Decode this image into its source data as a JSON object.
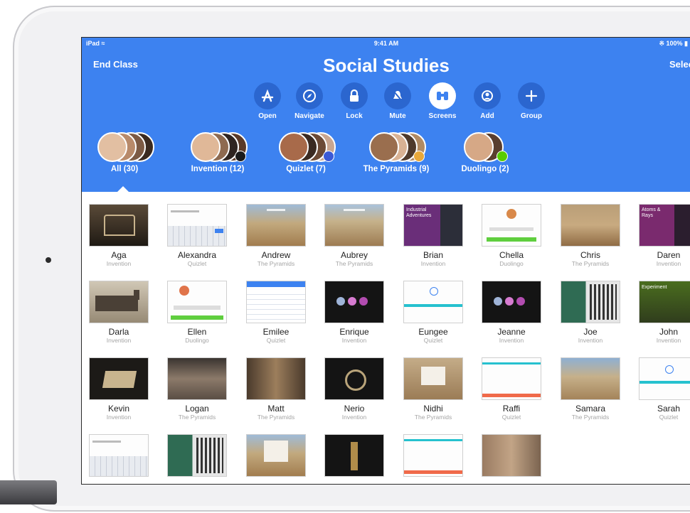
{
  "status_bar": {
    "device": "iPad",
    "time": "9:41 AM",
    "battery": "100%"
  },
  "header": {
    "end_class": "End Class",
    "title": "Social Studies",
    "select": "Select"
  },
  "toolbar": [
    {
      "label": "Open",
      "icon": "app-store-icon"
    },
    {
      "label": "Navigate",
      "icon": "compass-icon"
    },
    {
      "label": "Lock",
      "icon": "lock-icon"
    },
    {
      "label": "Mute",
      "icon": "mute-bell-icon"
    },
    {
      "label": "Screens",
      "icon": "binoculars-icon",
      "active": true
    },
    {
      "label": "Add",
      "icon": "add-student-icon"
    },
    {
      "label": "Group",
      "icon": "plus-icon"
    }
  ],
  "groups": [
    {
      "label": "All (30)",
      "selected": true
    },
    {
      "label": "Invention (12)"
    },
    {
      "label": "Quizlet (7)"
    },
    {
      "label": "The Pyramids (9)"
    },
    {
      "label": "Duolingo (2)"
    }
  ],
  "students": [
    {
      "name": "Aga",
      "app": "Invention"
    },
    {
      "name": "Alexandra",
      "app": "Quizlet"
    },
    {
      "name": "Andrew",
      "app": "The Pyramids"
    },
    {
      "name": "Aubrey",
      "app": "The Pyramids"
    },
    {
      "name": "Brian",
      "app": "Invention",
      "thumb_text": "Industrial Adventures"
    },
    {
      "name": "Chella",
      "app": "Duolingo"
    },
    {
      "name": "Chris",
      "app": "The Pyramids"
    },
    {
      "name": "Daren",
      "app": "Invention",
      "thumb_text": "Atoms & Rays"
    },
    {
      "name": "Darla",
      "app": "Invention"
    },
    {
      "name": "Ellen",
      "app": "Duolingo"
    },
    {
      "name": "Emilee",
      "app": "Quizlet"
    },
    {
      "name": "Enrique",
      "app": "Invention"
    },
    {
      "name": "Eungee",
      "app": "Quizlet"
    },
    {
      "name": "Jeanne",
      "app": "Invention"
    },
    {
      "name": "Joe",
      "app": "Invention"
    },
    {
      "name": "John",
      "app": "Invention",
      "thumb_text": "Experiment"
    },
    {
      "name": "Kevin",
      "app": "Invention"
    },
    {
      "name": "Logan",
      "app": "The Pyramids"
    },
    {
      "name": "Matt",
      "app": "The Pyramids"
    },
    {
      "name": "Nerio",
      "app": "Invention"
    },
    {
      "name": "Nidhi",
      "app": "The Pyramids"
    },
    {
      "name": "Raffi",
      "app": "Quizlet"
    },
    {
      "name": "Samara",
      "app": "The Pyramids"
    },
    {
      "name": "Sarah",
      "app": "Quizlet"
    }
  ],
  "colors": {
    "header_blue": "#3d82f0",
    "tool_circle": "#2b66cf"
  }
}
